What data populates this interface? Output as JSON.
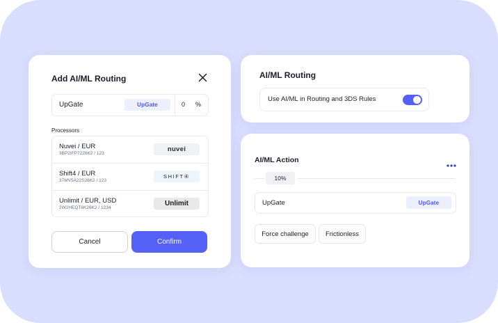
{
  "colors": {
    "background": "#d9defe",
    "accent": "#5561f6",
    "upgate_badge_text": "#4b55e8"
  },
  "add_routing": {
    "title": "Add AI/ML Routing",
    "close_icon": "close-icon",
    "upgate_row": {
      "label": "UpGate",
      "badge": "UpGate",
      "percent_value": "0",
      "percent_unit": "%"
    },
    "processors_label": "Processors",
    "processors": [
      {
        "name": "Nuvei / EUR",
        "id": "3BP2IFP7226K2 / 123",
        "logo": "nuvei"
      },
      {
        "name": "Shift4 / EUR",
        "id": "37MV5A22S26K2 / 123",
        "logo": "SHIFT④"
      },
      {
        "name": "Unlimit / EUR, USD",
        "id": "2W2HEQT6K26K2 / 1234",
        "logo": "Unlimit"
      }
    ],
    "cancel_label": "Cancel",
    "confirm_label": "Confirm"
  },
  "routing_card": {
    "title": "AI/ML Routing",
    "toggle_label": "Use AI/ML in Routing and 3DS Rules",
    "toggle_on": true
  },
  "action_card": {
    "title": "AI/ML Action",
    "more_icon": "more-horizontal-icon",
    "percent": "10%",
    "upgate_label": "UpGate",
    "upgate_badge": "UpGate",
    "force_challenge_label": "Force challenge",
    "frictionless_label": "Frictionless"
  }
}
